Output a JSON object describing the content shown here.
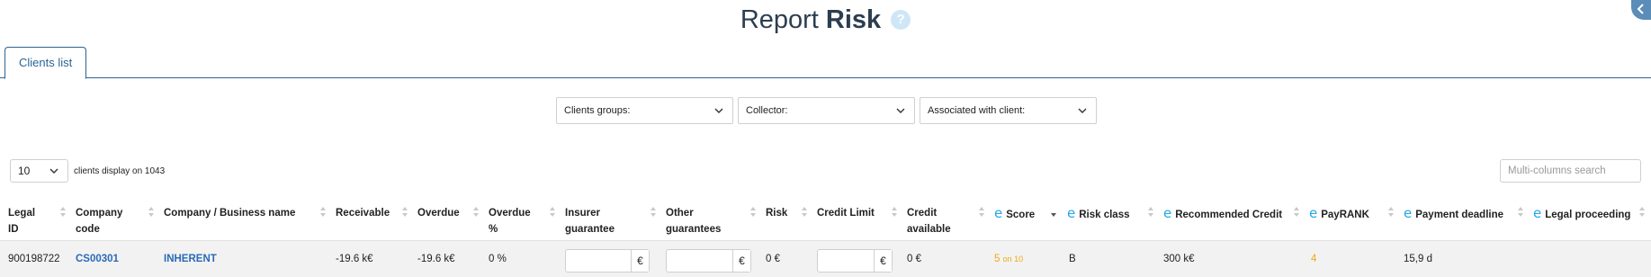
{
  "header": {
    "title_light": "Report",
    "title_bold": "Risk",
    "help_icon": "?"
  },
  "tabs": [
    {
      "label": "Clients list",
      "active": true
    }
  ],
  "filters": [
    {
      "label": "Clients groups:"
    },
    {
      "label": "Collector:"
    },
    {
      "label": "Associated with client:"
    }
  ],
  "length_select": {
    "value": "10",
    "info": "clients display on 1043"
  },
  "search": {
    "placeholder": "Multi-columns search"
  },
  "table": {
    "columns": [
      {
        "line1": "Legal",
        "line2": "ID"
      },
      {
        "line1": "Company",
        "line2": "code"
      },
      {
        "line1": "Company / Business name"
      },
      {
        "line1": "Receivable"
      },
      {
        "line1": "Overdue"
      },
      {
        "line1": "Overdue",
        "line2": "%"
      },
      {
        "line1": "Insurer",
        "line2": "guarantee"
      },
      {
        "line1": "Other",
        "line2": "guarantees"
      },
      {
        "line1": "Risk"
      },
      {
        "line1": "Credit Limit"
      },
      {
        "line1": "Credit",
        "line2": "available"
      },
      {
        "icon": "e",
        "line1": "Score"
      },
      {
        "icon": "e",
        "line1": "Risk class"
      },
      {
        "icon": "e",
        "line1": "Recommended Credit"
      },
      {
        "icon": "e",
        "line1": "PayRANK"
      },
      {
        "icon": "e",
        "line1": "Payment deadline"
      },
      {
        "icon": "e",
        "line1": "Legal proceeding"
      }
    ],
    "rows": [
      {
        "legal_id": "900198722",
        "company_code": "CS00301",
        "business_name": "INHERENT",
        "receivable": "-19.6 k€",
        "overdue": "-19.6 k€",
        "overdue_pct": "0 %",
        "insurer_currency": "€",
        "other_currency": "€",
        "risk": "0 €",
        "credit_limit_currency": "€",
        "credit_available": "0 €",
        "score": "5",
        "score_suffix": "on 10",
        "risk_class": "B",
        "recommended_credit": "300 k€",
        "payrank": "4",
        "payment_deadline": "15,9 d",
        "legal_proceeding": ""
      }
    ]
  },
  "colors": {
    "accent": "#2a6496",
    "link": "#2a6ab8",
    "score": "#f0a818",
    "ellisphere": "#22a7e8"
  }
}
